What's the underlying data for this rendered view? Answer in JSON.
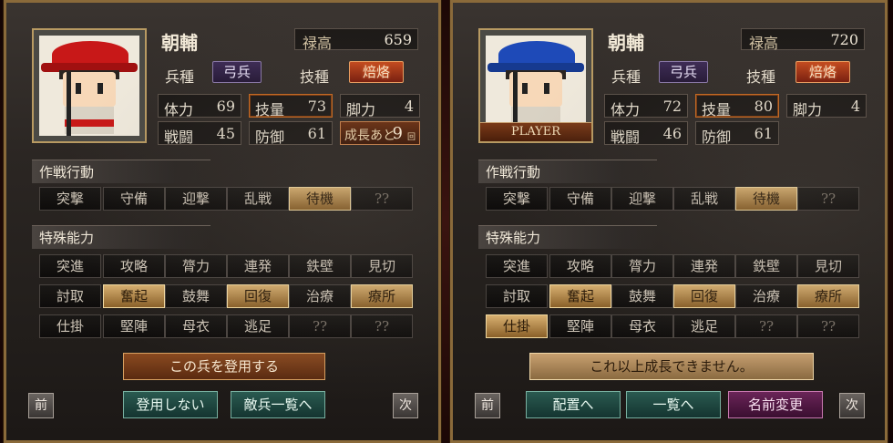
{
  "left": {
    "name": "朝輔",
    "salary_label": "禄高",
    "salary_value": "659",
    "troop_label": "兵種",
    "troop_value": "弓兵",
    "tech_label": "技種",
    "tech_value": "焙烙",
    "stats": [
      {
        "label": "体力",
        "value": "69"
      },
      {
        "label": "技量",
        "value": "73"
      },
      {
        "label": "脚力",
        "value": "4"
      },
      {
        "label": "戦闘",
        "value": "45"
      },
      {
        "label": "防御",
        "value": "61"
      }
    ],
    "growth_label": "成長あと",
    "growth_value": "9",
    "growth_unit": "回",
    "hat_color": "#c81818",
    "sash_color": "#c81818",
    "tactics_title": "作戦行動",
    "tactics": [
      {
        "label": "突撃",
        "on": false
      },
      {
        "label": "守備",
        "on": false
      },
      {
        "label": "迎撃",
        "on": false
      },
      {
        "label": "乱戦",
        "on": false
      },
      {
        "label": "待機",
        "on": true
      },
      {
        "label": "??",
        "on": false
      }
    ],
    "abilities_title": "特殊能力",
    "abilities": [
      {
        "label": "突進",
        "on": false
      },
      {
        "label": "攻略",
        "on": false
      },
      {
        "label": "膂力",
        "on": false
      },
      {
        "label": "連発",
        "on": false
      },
      {
        "label": "鉄壁",
        "on": false
      },
      {
        "label": "見切",
        "on": false
      },
      {
        "label": "討取",
        "on": false
      },
      {
        "label": "奮起",
        "on": true
      },
      {
        "label": "鼓舞",
        "on": false
      },
      {
        "label": "回復",
        "on": true
      },
      {
        "label": "治療",
        "on": false
      },
      {
        "label": "療所",
        "on": true
      },
      {
        "label": "仕掛",
        "on": false
      },
      {
        "label": "堅陣",
        "on": false
      },
      {
        "label": "母衣",
        "on": false
      },
      {
        "label": "逃足",
        "on": false
      },
      {
        "label": "??",
        "on": false
      },
      {
        "label": "??",
        "on": false
      }
    ],
    "main_action": "この兵を登用する",
    "prev_label": "前",
    "next_label": "次",
    "btn_a": "登用しない",
    "btn_b": "敵兵一覧へ"
  },
  "right": {
    "name": "朝輔",
    "salary_label": "禄高",
    "salary_value": "720",
    "troop_label": "兵種",
    "troop_value": "弓兵",
    "tech_label": "技種",
    "tech_value": "焙烙",
    "player_tag": "PLAYER",
    "stats": [
      {
        "label": "体力",
        "value": "72"
      },
      {
        "label": "技量",
        "value": "80"
      },
      {
        "label": "脚力",
        "value": "4"
      },
      {
        "label": "戦闘",
        "value": "46"
      },
      {
        "label": "防御",
        "value": "61"
      }
    ],
    "hat_color": "#1e4ab8",
    "sash_color": "#1e4ab8",
    "tactics_title": "作戦行動",
    "tactics": [
      {
        "label": "突撃",
        "on": false
      },
      {
        "label": "守備",
        "on": false
      },
      {
        "label": "迎撃",
        "on": false
      },
      {
        "label": "乱戦",
        "on": false
      },
      {
        "label": "待機",
        "on": true
      },
      {
        "label": "??",
        "on": false
      }
    ],
    "abilities_title": "特殊能力",
    "abilities": [
      {
        "label": "突進",
        "on": false
      },
      {
        "label": "攻略",
        "on": false
      },
      {
        "label": "膂力",
        "on": false
      },
      {
        "label": "連発",
        "on": false
      },
      {
        "label": "鉄壁",
        "on": false
      },
      {
        "label": "見切",
        "on": false
      },
      {
        "label": "討取",
        "on": false
      },
      {
        "label": "奮起",
        "on": true
      },
      {
        "label": "鼓舞",
        "on": false
      },
      {
        "label": "回復",
        "on": true
      },
      {
        "label": "治療",
        "on": false
      },
      {
        "label": "療所",
        "on": true
      },
      {
        "label": "仕掛",
        "on": true
      },
      {
        "label": "堅陣",
        "on": false
      },
      {
        "label": "母衣",
        "on": false
      },
      {
        "label": "逃足",
        "on": false
      },
      {
        "label": "??",
        "on": false
      },
      {
        "label": "??",
        "on": false
      }
    ],
    "main_action": "これ以上成長できません。",
    "prev_label": "前",
    "next_label": "次",
    "btn_a": "配置へ",
    "btn_b": "一覧へ",
    "btn_c": "名前変更"
  }
}
